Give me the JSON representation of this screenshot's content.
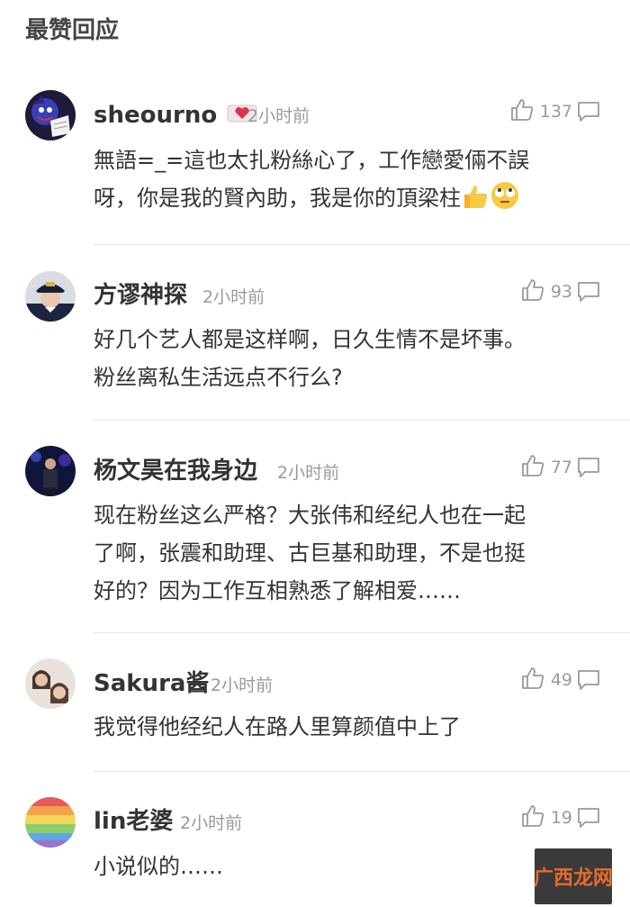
{
  "section_title": "最赞回应",
  "watermark": "广西龙网",
  "comments": [
    {
      "username": "sheourno",
      "time": "2小时前",
      "likes": "137",
      "text_line1": "無語=_=這也太扎粉絲心了，工作戀愛倆不誤",
      "text_line2": "呀，你是我的賢內助，我是你的頂梁柱",
      "avatar_icon": "dark-character-avatar",
      "badge_icon": "heart-badge-icon",
      "emoji": [
        "thumbs-up-emoji",
        "eye-roll-emoji"
      ]
    },
    {
      "username": "方谬神探",
      "time": "2小时前",
      "likes": "93",
      "text_line1": "好几个艺人都是这样啊，日久生情不是坏事。",
      "text_line2": "粉丝离私生活远点不行么?",
      "avatar_icon": "person-cap-avatar"
    },
    {
      "username": "杨文昊在我身边",
      "time": "2小时前",
      "likes": "77",
      "text_line1": "现在粉丝这么严格？大张伟和经纪人也在一起",
      "text_line2": "了啊，张震和助理、古巨基和助理，不是也挺",
      "text_line3": "好的？因为工作互相熟悉了解相爱……",
      "avatar_icon": "stage-performer-avatar"
    },
    {
      "username": "Sakura酱",
      "time": "2小时前",
      "likes": "49",
      "text_line1": "我觉得他经纪人在路人里算颜值中上了",
      "avatar_icon": "two-people-avatar"
    },
    {
      "username": "lin老婆",
      "time": "2小时前",
      "likes": "19",
      "text_line1": "小说似的……",
      "avatar_icon": "rainbow-avatar"
    }
  ],
  "colors": {
    "text": "#333333",
    "muted": "#9a9a9a",
    "divider": "#e4e4e4",
    "watermark_text": "#e86a2c"
  }
}
